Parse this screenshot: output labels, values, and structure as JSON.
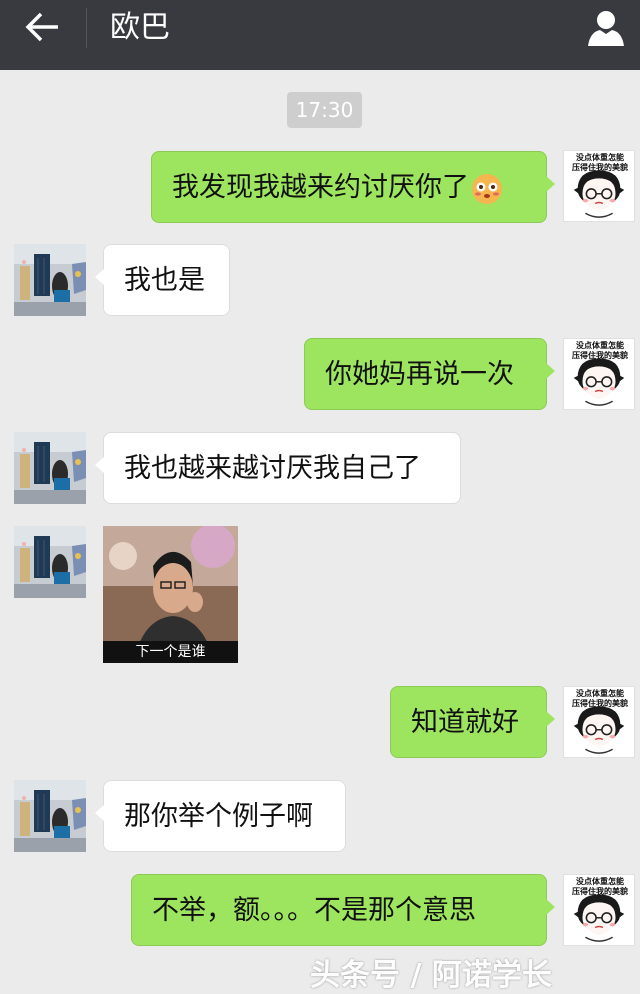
{
  "header": {
    "title": "欧巴"
  },
  "chat": {
    "time_label": "17:30",
    "messages": [
      {
        "sender": "me",
        "text": "我发现我越来约讨厌你了"
      },
      {
        "sender": "other",
        "text": "我也是"
      },
      {
        "sender": "me",
        "text": "你她妈再说一次"
      },
      {
        "sender": "other",
        "text": "我也越来越讨厌我自己了"
      },
      {
        "sender": "other",
        "image_caption": "下一个是谁"
      },
      {
        "sender": "me",
        "text": "知道就好"
      },
      {
        "sender": "other",
        "text": "那你举个例子啊"
      },
      {
        "sender": "me",
        "text": "不举，额。。。不是那个意思"
      }
    ],
    "my_avatar_caption": [
      "没点体重怎能",
      "压得住我的美貌"
    ]
  },
  "watermark": "头条号 / 阿诺学长",
  "colors": {
    "header": "#393a3f",
    "my_bubble": "#9ee55f",
    "background": "#ebebeb"
  }
}
